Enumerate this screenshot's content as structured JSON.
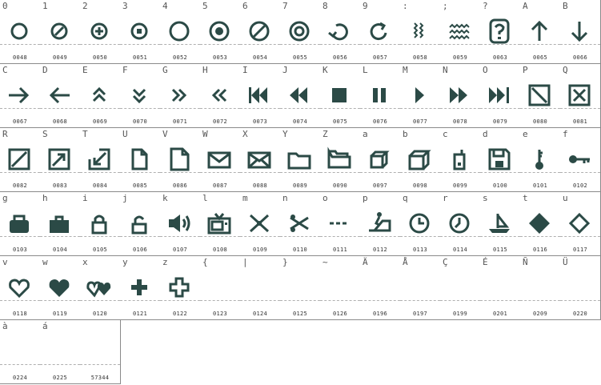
{
  "font_map": {
    "cells": [
      {
        "char": "0",
        "code": "0048",
        "icon": "circle-icon"
      },
      {
        "char": "1",
        "code": "0049",
        "icon": "circle-slash-icon"
      },
      {
        "char": "2",
        "code": "0050",
        "icon": "circle-plus-icon"
      },
      {
        "char": "3",
        "code": "0051",
        "icon": "target-icon"
      },
      {
        "char": "4",
        "code": "0052",
        "icon": "circle-large-icon"
      },
      {
        "char": "5",
        "code": "0053",
        "icon": "record-icon"
      },
      {
        "char": "6",
        "code": "0054",
        "icon": "circle-slash-large-icon"
      },
      {
        "char": "7",
        "code": "0055",
        "icon": "concentric-circle-icon"
      },
      {
        "char": "8",
        "code": "0056",
        "icon": "rotate-left-icon"
      },
      {
        "char": "9",
        "code": "0057",
        "icon": "rotate-right-icon"
      },
      {
        "char": ":",
        "code": "0058",
        "icon": "wavy-vertical-icon"
      },
      {
        "char": ";",
        "code": "0059",
        "icon": "wavy-horizontal-icon"
      },
      {
        "char": "?",
        "code": "0063",
        "icon": "question-box-icon"
      },
      {
        "char": "A",
        "code": "0065",
        "icon": "arrow-up-icon"
      },
      {
        "char": "B",
        "code": "0066",
        "icon": "arrow-down-icon"
      },
      {
        "char": "C",
        "code": "0067",
        "icon": "arrow-right-icon"
      },
      {
        "char": "D",
        "code": "0068",
        "icon": "arrow-left-icon"
      },
      {
        "char": "E",
        "code": "0069",
        "icon": "chevrons-up-icon"
      },
      {
        "char": "F",
        "code": "0070",
        "icon": "chevrons-down-icon"
      },
      {
        "char": "G",
        "code": "0071",
        "icon": "chevrons-right-icon"
      },
      {
        "char": "H",
        "code": "0072",
        "icon": "chevrons-left-icon"
      },
      {
        "char": "I",
        "code": "0073",
        "icon": "skip-back-icon"
      },
      {
        "char": "J",
        "code": "0074",
        "icon": "rewind-icon"
      },
      {
        "char": "K",
        "code": "0075",
        "icon": "stop-icon"
      },
      {
        "char": "L",
        "code": "0076",
        "icon": "pause-icon"
      },
      {
        "char": "M",
        "code": "0077",
        "icon": "play-icon"
      },
      {
        "char": "N",
        "code": "0078",
        "icon": "fast-forward-icon"
      },
      {
        "char": "O",
        "code": "0079",
        "icon": "skip-forward-icon"
      },
      {
        "char": "P",
        "code": "0080",
        "icon": "box-diagonal-icon"
      },
      {
        "char": "Q",
        "code": "0081",
        "icon": "box-x-icon"
      },
      {
        "char": "R",
        "code": "0082",
        "icon": "box-slash-icon"
      },
      {
        "char": "S",
        "code": "0083",
        "icon": "expand-icon"
      },
      {
        "char": "T",
        "code": "0084",
        "icon": "collapse-icon"
      },
      {
        "char": "U",
        "code": "0085",
        "icon": "document-icon"
      },
      {
        "char": "V",
        "code": "0086",
        "icon": "document-large-icon"
      },
      {
        "char": "W",
        "code": "0087",
        "icon": "envelope-icon"
      },
      {
        "char": "X",
        "code": "0088",
        "icon": "envelope-open-icon"
      },
      {
        "char": "Y",
        "code": "0089",
        "icon": "folder-icon"
      },
      {
        "char": "Z",
        "code": "0090",
        "icon": "folders-icon"
      },
      {
        "char": "a",
        "code": "0097",
        "icon": "cube-icon"
      },
      {
        "char": "b",
        "code": "0098",
        "icon": "cube-large-icon"
      },
      {
        "char": "c",
        "code": "0099",
        "icon": "mobile-phone-icon"
      },
      {
        "char": "d",
        "code": "0100",
        "icon": "floppy-disk-icon"
      },
      {
        "char": "e",
        "code": "0101",
        "icon": "key-vertical-icon"
      },
      {
        "char": "f",
        "code": "0102",
        "icon": "key-horizontal-icon"
      },
      {
        "char": "g",
        "code": "0103",
        "icon": "bag-icon"
      },
      {
        "char": "h",
        "code": "0104",
        "icon": "briefcase-icon"
      },
      {
        "char": "i",
        "code": "0105",
        "icon": "lock-icon"
      },
      {
        "char": "j",
        "code": "0106",
        "icon": "unlock-icon"
      },
      {
        "char": "k",
        "code": "0107",
        "icon": "speaker-icon"
      },
      {
        "char": "l",
        "code": "0108",
        "icon": "tv-icon"
      },
      {
        "char": "m",
        "code": "0109",
        "icon": "scissors-icon"
      },
      {
        "char": "n",
        "code": "0110",
        "icon": "scissors-open-icon"
      },
      {
        "char": "o",
        "code": "0111",
        "icon": "dashed-line-icon"
      },
      {
        "char": "p",
        "code": "0112",
        "icon": "escalator-icon"
      },
      {
        "char": "q",
        "code": "0113",
        "icon": "clock-icon"
      },
      {
        "char": "r",
        "code": "0114",
        "icon": "clock-alt-icon"
      },
      {
        "char": "s",
        "code": "0115",
        "icon": "sailboat-icon"
      },
      {
        "char": "t",
        "code": "0116",
        "icon": "diamond-solid-icon"
      },
      {
        "char": "u",
        "code": "0117",
        "icon": "diamond-outline-icon"
      },
      {
        "char": "v",
        "code": "0118",
        "icon": "heart-outline-icon"
      },
      {
        "char": "w",
        "code": "0119",
        "icon": "heart-solid-icon"
      },
      {
        "char": "x",
        "code": "0120",
        "icon": "hearts-pair-icon"
      },
      {
        "char": "y",
        "code": "0121",
        "icon": "plus-solid-icon"
      },
      {
        "char": "z",
        "code": "0122",
        "icon": "plus-outline-icon"
      },
      {
        "char": "{",
        "code": "0123",
        "icon": ""
      },
      {
        "char": "|",
        "code": "0124",
        "icon": ""
      },
      {
        "char": "}",
        "code": "0125",
        "icon": ""
      },
      {
        "char": "~",
        "code": "0126",
        "icon": ""
      },
      {
        "char": "Ä",
        "code": "0196",
        "icon": ""
      },
      {
        "char": "Å",
        "code": "0197",
        "icon": ""
      },
      {
        "char": "Ç",
        "code": "0199",
        "icon": ""
      },
      {
        "char": "É",
        "code": "0201",
        "icon": ""
      },
      {
        "char": "Ñ",
        "code": "0209",
        "icon": ""
      },
      {
        "char": "Ü",
        "code": "0220",
        "icon": ""
      },
      {
        "char": "à",
        "code": "0224",
        "icon": ""
      },
      {
        "char": "á",
        "code": "0225",
        "icon": ""
      },
      {
        "char": "",
        "code": "57344",
        "icon": ""
      }
    ]
  },
  "colors": {
    "glyph": "#2b4a46",
    "border": "#8a8a8a",
    "text": "#555555"
  }
}
